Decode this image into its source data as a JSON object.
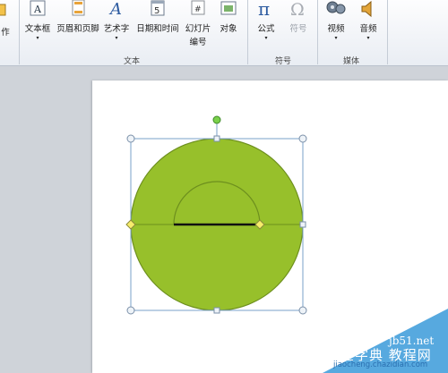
{
  "ribbon": {
    "partial_left_label": "作",
    "buttons": {
      "textbox": "文本框",
      "header_footer": "页眉和页脚",
      "wordart": "艺术字",
      "datetime": "日期和时间",
      "slide_number_line1": "幻灯片",
      "slide_number_line2": "编号",
      "object": "对象",
      "equation": "公式",
      "symbol": "符号",
      "video": "视频",
      "audio": "音频"
    },
    "groups": {
      "text": "文本",
      "symbols": "符号",
      "media": "媒体"
    },
    "icon_glyphs": {
      "wordart": "A",
      "datetime": "5",
      "slide_number": "#",
      "equation": "π",
      "symbol": "Ω"
    }
  },
  "shape": {
    "fill_color": "#97c02b",
    "outline_color": "#6d8f1e",
    "handle_rotate_color": "#7ad04a",
    "handle_adjust_color": "#f7ec6b"
  },
  "watermark": {
    "line1": "jb51.net",
    "line2": "查字典 教程网",
    "line3": "jiaocheng.chazidian.com"
  }
}
